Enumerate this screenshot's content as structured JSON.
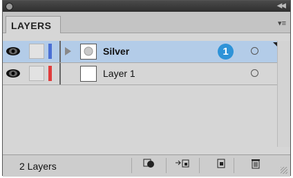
{
  "panel": {
    "tab_label": "LAYERS",
    "menu_icon": "panel-menu-icon"
  },
  "layers": [
    {
      "name": "Silver",
      "selected": true,
      "color": "#4a6fd4",
      "badge": "1"
    },
    {
      "name": "Layer 1",
      "selected": false,
      "color": "#e03c3c"
    }
  ],
  "footer": {
    "count_label": "2 Layers"
  },
  "colors": {
    "selection": "#b3cce8",
    "badge": "#2e93d8"
  }
}
